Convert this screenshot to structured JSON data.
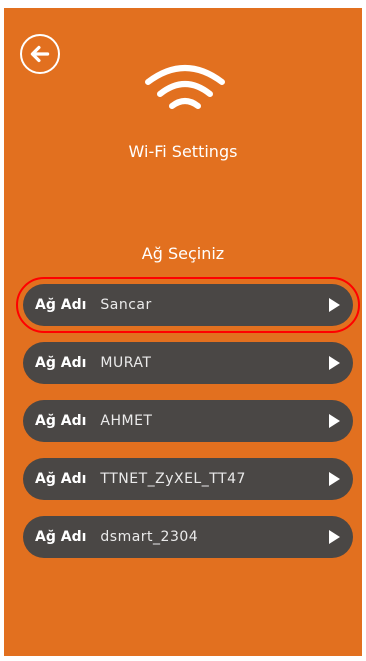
{
  "header": {
    "title": "Wi-Fi Settings"
  },
  "list": {
    "subtitle": "Ağ Seçiniz",
    "items": [
      {
        "label": "Ağ Adı",
        "name": "Sancar"
      },
      {
        "label": "Ağ Adı",
        "name": "MURAT"
      },
      {
        "label": "Ağ Adı",
        "name": "AHMET"
      },
      {
        "label": "Ağ Adı",
        "name": "TTNET_ZyXEL_TT47"
      },
      {
        "label": "Ağ Adı",
        "name": "dsmart_2304"
      }
    ]
  },
  "icons": {
    "back": "back-arrow-icon",
    "wifi": "wifi-icon",
    "chevron": "chevron-right-icon"
  },
  "colors": {
    "background": "#e2701f",
    "item_bg": "#4a4745",
    "highlight": "#ff0000"
  }
}
